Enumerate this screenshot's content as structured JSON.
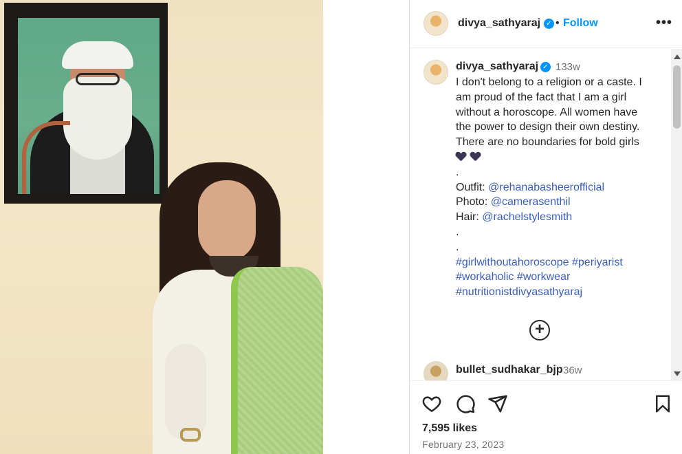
{
  "post": {
    "username": "divya_sathyaraj",
    "follow_label": "Follow",
    "separator": "•",
    "more_label": "•••"
  },
  "caption": {
    "username": "divya_sathyaraj",
    "time": "133w",
    "lines": [
      "I don't belong to a religion or a caste. I",
      "am proud of the fact that I am a girl",
      "without a horoscope. All women have",
      "the power to design their own destiny.",
      "There are no boundaries for bold girls"
    ],
    "dot": ".",
    "outfit_label": "Outfit: ",
    "outfit_handle": "@rehanabasheerofficial",
    "photo_label": "Photo: ",
    "photo_handle": "@camerasenthil",
    "hair_label": "Hair: ",
    "hair_handle": "@rachelstylesmith",
    "hashtags": [
      "#girlwithoutahoroscope #periyarist",
      "#workaholic #workwear",
      "#nutritionistdivyasathyaraj"
    ]
  },
  "load_more_label": "+",
  "comment": {
    "username": "bullet_sudhakar_bjp",
    "time": "36w"
  },
  "likes_text": "7,595 likes",
  "date_text": "February 23, 2023",
  "colors": {
    "accent": "#0095f6",
    "link": "#3a5fb8",
    "muted": "#737373"
  },
  "icons": [
    "heart-icon",
    "comment-icon",
    "share-icon",
    "bookmark-icon",
    "verified-icon",
    "plus-circle-icon"
  ]
}
